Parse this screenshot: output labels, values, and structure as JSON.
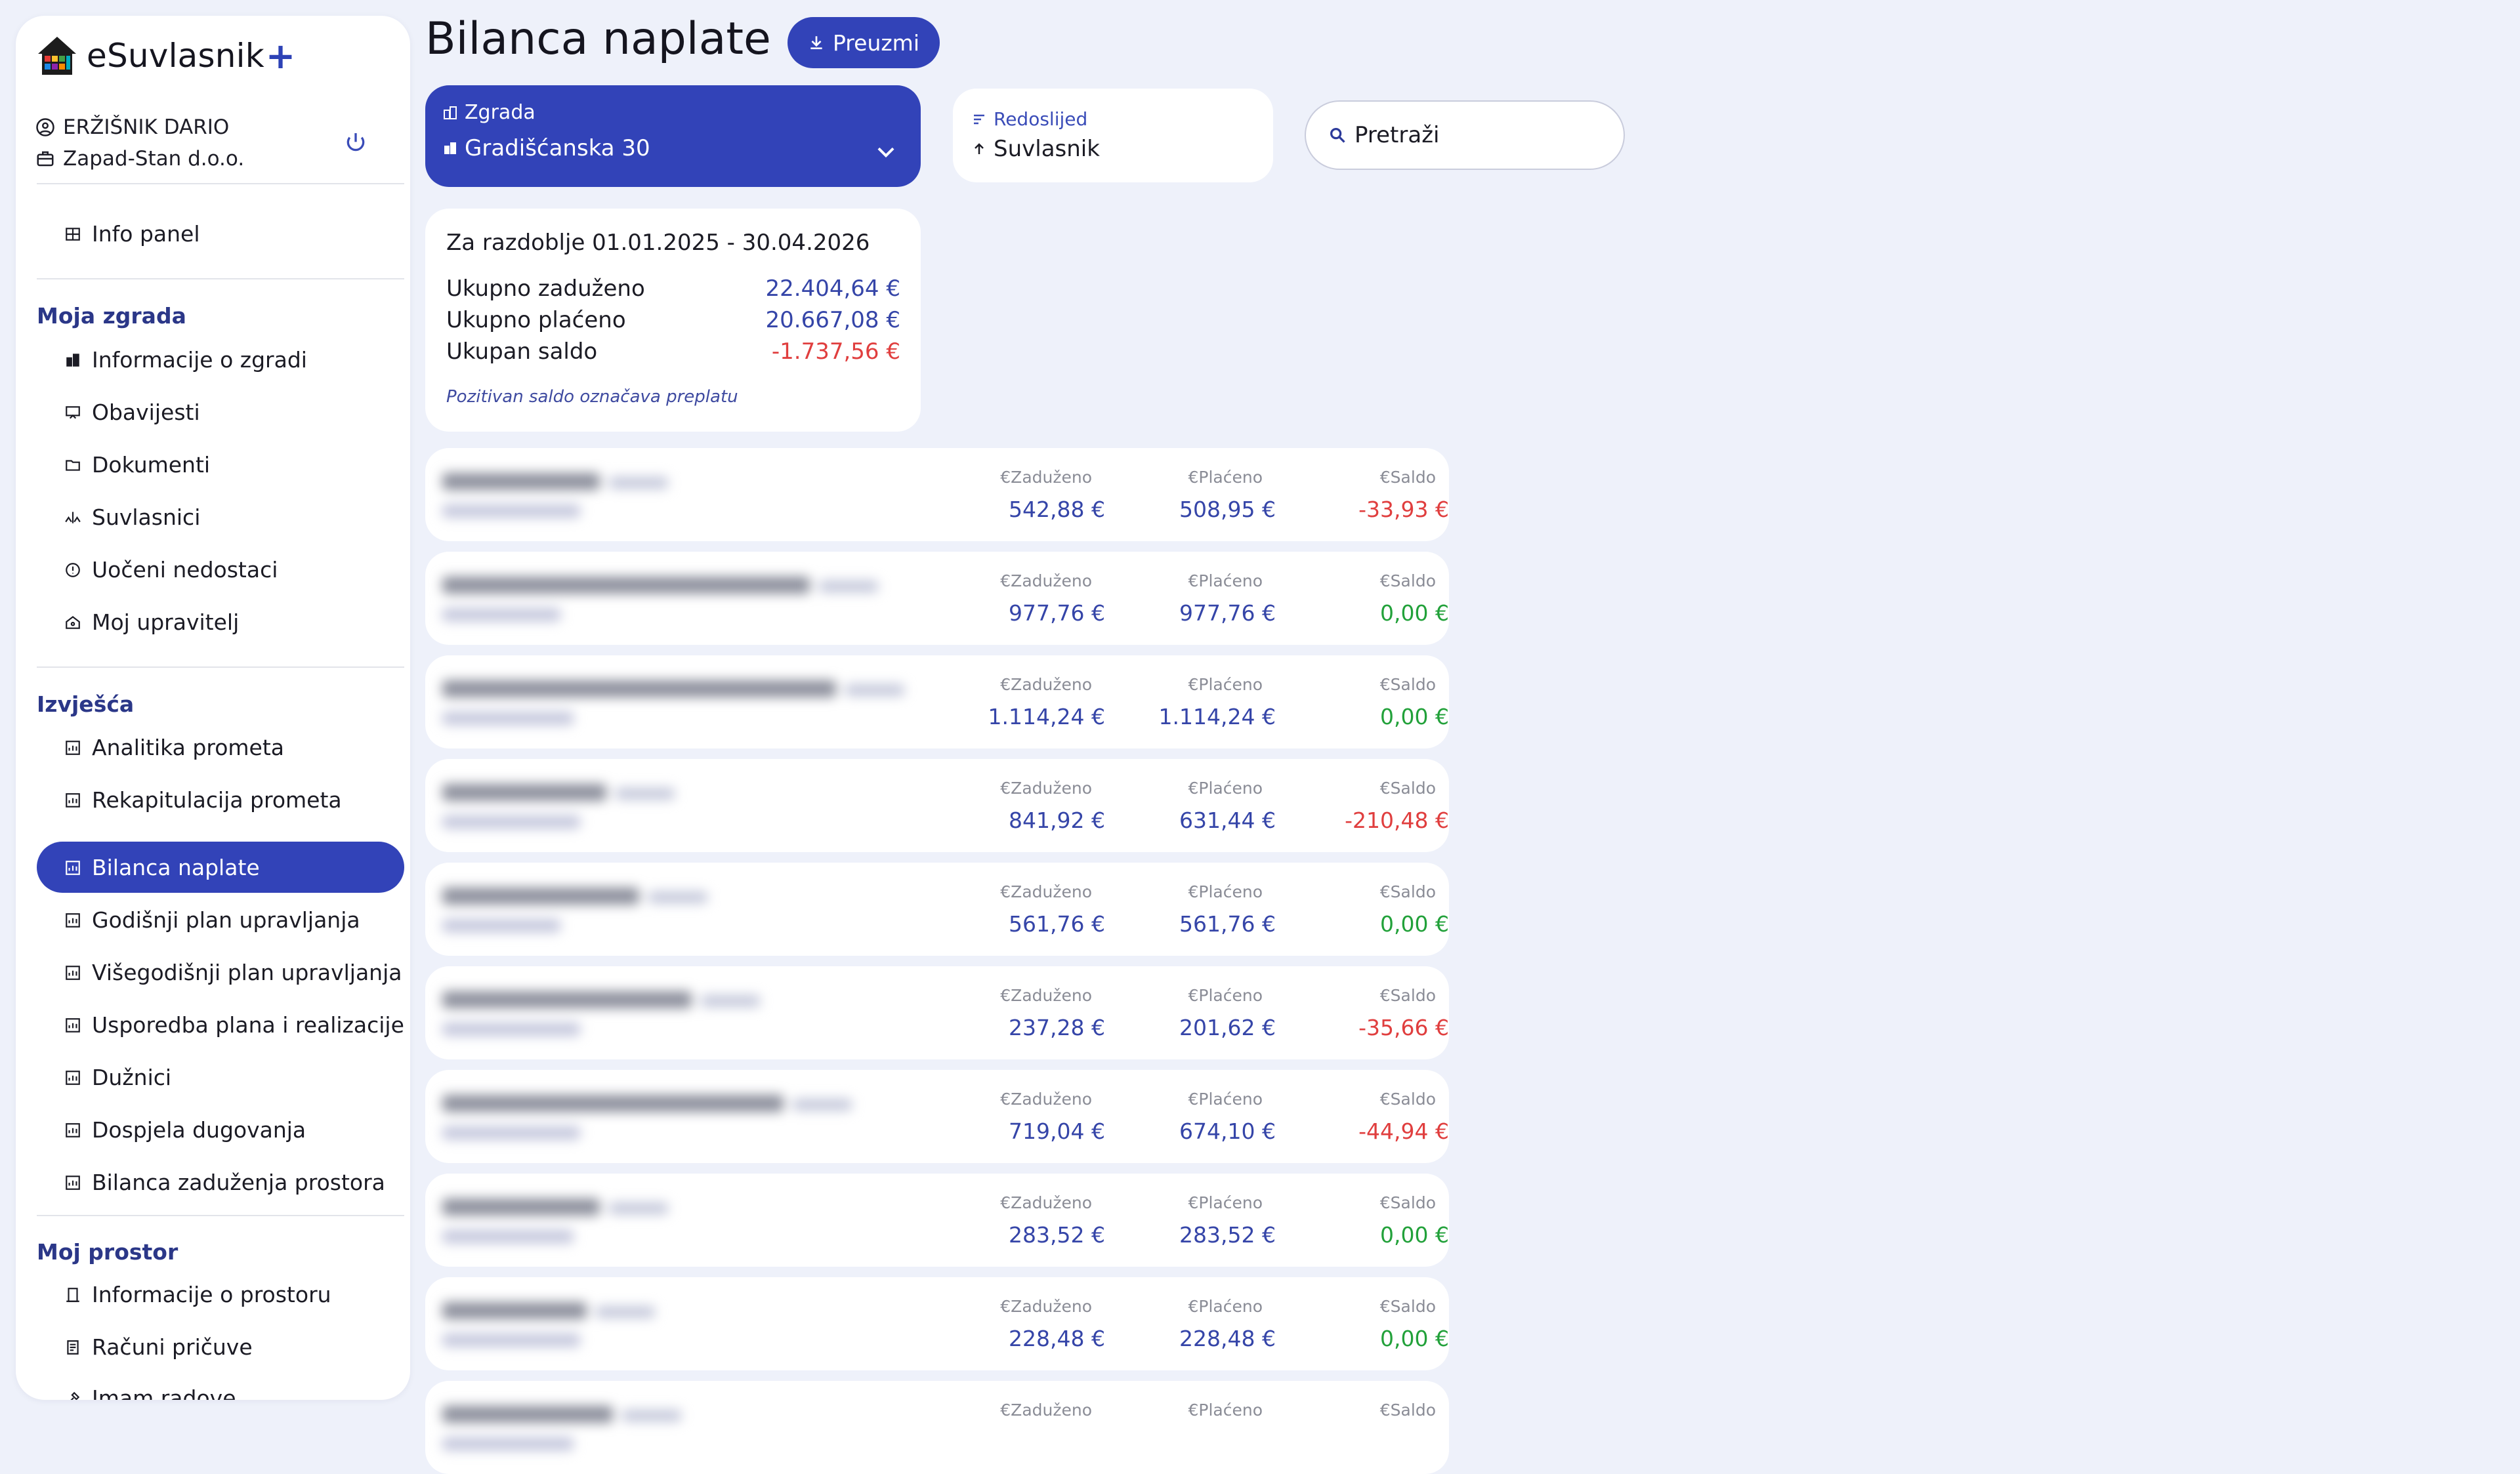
{
  "app": {
    "name": "eSuvlasnik"
  },
  "user": {
    "name": "ERŽIŠNIK DARIO",
    "company": "Zapad-Stan d.o.o."
  },
  "sidebar": {
    "top_item": "Info panel",
    "sections": [
      {
        "title": "Moja zgrada",
        "items": [
          "Informacije o zgradi",
          "Obavijesti",
          "Dokumenti",
          "Suvlasnici",
          "Uočeni nedostaci",
          "Moj upravitelj"
        ]
      },
      {
        "title": "Izvješća",
        "items": [
          "Analitika prometa",
          "Rekapitulacija prometa",
          "Bilanca naplate",
          "Godišnji plan upravljanja",
          "Višegodišnji plan upravljanja",
          "Usporedba plana i realizacije",
          "Dužnici",
          "Dospjela dugovanja",
          "Bilanca zaduženja prostora"
        ]
      },
      {
        "title": "Moj prostor",
        "items": [
          "Informacije o prostoru",
          "Računi pričuve",
          "Imam radove"
        ]
      }
    ],
    "active_item": "Bilanca naplate"
  },
  "header": {
    "title": "Bilanca naplate",
    "download_label": "Preuzmi"
  },
  "filters": {
    "building_label": "Zgrada",
    "building_value": "Gradišćanska 30",
    "order_label": "Redoslijed",
    "order_value": "Suvlasnik",
    "search_placeholder": "Pretraži"
  },
  "summary": {
    "period": "Za razdoblje 01.01.2025 - 30.04.2026",
    "rows": [
      {
        "label": "Ukupno zaduženo",
        "value": "22.404,64 €"
      },
      {
        "label": "Ukupno plaćeno",
        "value": "20.667,08 €"
      },
      {
        "label": "Ukupan saldo",
        "value": "-1.737,56 €"
      }
    ],
    "note": "Pozitivan saldo označava preplatu"
  },
  "columns": {
    "charged": "€Zaduženo",
    "paid": "€Plaćeno",
    "balance": "€Saldo"
  },
  "owners": [
    {
      "charged": "542,88 €",
      "paid": "508,95 €",
      "balance": "-33,93 €",
      "status": "negative"
    },
    {
      "charged": "977,76 €",
      "paid": "977,76 €",
      "balance": "0,00 €",
      "status": "zero"
    },
    {
      "charged": "1.114,24 €",
      "paid": "1.114,24 €",
      "balance": "0,00 €",
      "status": "zero"
    },
    {
      "charged": "841,92 €",
      "paid": "631,44 €",
      "balance": "-210,48 €",
      "status": "negative"
    },
    {
      "charged": "561,76 €",
      "paid": "561,76 €",
      "balance": "0,00 €",
      "status": "zero"
    },
    {
      "charged": "237,28 €",
      "paid": "201,62 €",
      "balance": "-35,66 €",
      "status": "negative"
    },
    {
      "charged": "719,04 €",
      "paid": "674,10 €",
      "balance": "-44,94 €",
      "status": "negative"
    },
    {
      "charged": "283,52 €",
      "paid": "283,52 €",
      "balance": "0,00 €",
      "status": "zero"
    },
    {
      "charged": "228,48 €",
      "paid": "228,48 €",
      "balance": "0,00 €",
      "status": "zero"
    },
    {
      "charged": "",
      "paid": "",
      "balance": "",
      "status": "zero"
    }
  ],
  "colors": {
    "accent": "#3243b8",
    "negative": "#e03e3e",
    "positive": "#22a13a",
    "value": "#3545a8"
  }
}
